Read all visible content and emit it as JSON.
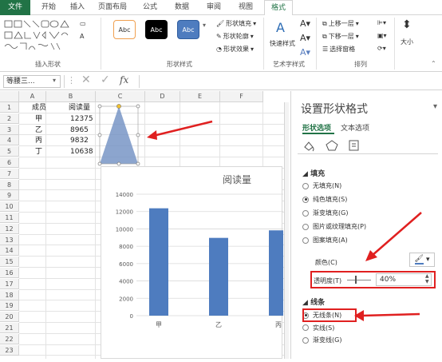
{
  "tabs": {
    "file": "文件",
    "home": "开始",
    "insert": "插入",
    "layout": "页面布局",
    "formulas": "公式",
    "data": "数据",
    "review": "审阅",
    "view": "视图",
    "format": "格式"
  },
  "ribbon": {
    "insert_shapes_label": "插入形状",
    "shape_styles_label": "形状样式",
    "wordart_label": "艺术字样式",
    "arrange_label": "排列",
    "style_sample": "Abc",
    "shape_fill": "形状填充",
    "shape_outline": "形状轮廓",
    "shape_effects": "形状效果",
    "quick_styles": "快速样式",
    "bring_forward": "上移一层",
    "send_backward": "下移一层",
    "selection_pane": "选择窗格",
    "size": "大小"
  },
  "formula_bar": {
    "name_box": "等腰三...",
    "fx": "fx"
  },
  "sheet": {
    "columns": [
      "A",
      "B",
      "C",
      "D",
      "E",
      "F"
    ],
    "rows": [
      "1",
      "2",
      "3",
      "4",
      "5",
      "6",
      "7",
      "8",
      "9",
      "10",
      "11",
      "12",
      "13",
      "14",
      "15",
      "16",
      "17",
      "18",
      "19",
      "20",
      "21",
      "22",
      "23"
    ],
    "header": [
      "成员",
      "阅读量"
    ],
    "data": [
      {
        "name": "甲",
        "value": "12375"
      },
      {
        "name": "乙",
        "value": "8965"
      },
      {
        "name": "丙",
        "value": "9832"
      },
      {
        "name": "丁",
        "value": "10638"
      }
    ]
  },
  "chart_data": {
    "type": "bar",
    "title": "阅读量",
    "categories": [
      "甲",
      "乙",
      "丙"
    ],
    "values": [
      12375,
      8965,
      9832
    ],
    "ylim": [
      0,
      14000
    ],
    "yticks": [
      "14000",
      "12000",
      "10000",
      "8000",
      "6000",
      "4000",
      "2000",
      "0"
    ],
    "bar_color": "#4e7cbf",
    "grid": true
  },
  "pane": {
    "title": "设置形状格式",
    "tab_shape": "形状选项",
    "tab_text": "文本选项",
    "fill_section": "填充",
    "fill_options": [
      "无填充(N)",
      "纯色填充(S)",
      "渐变填充(G)",
      "图片或纹理填充(P)",
      "图案填充(A)"
    ],
    "fill_selected": 1,
    "color_label": "颜色(C)",
    "transparency_label": "透明度(T)",
    "transparency_value": "40%",
    "line_section": "线条",
    "line_options": [
      "无线条(N)",
      "实线(S)",
      "渐变线(G)"
    ],
    "line_selected": 0
  },
  "colors": {
    "accent": "#217346",
    "highlight": "#e02020",
    "shape_fill": "#6f8fc2"
  }
}
